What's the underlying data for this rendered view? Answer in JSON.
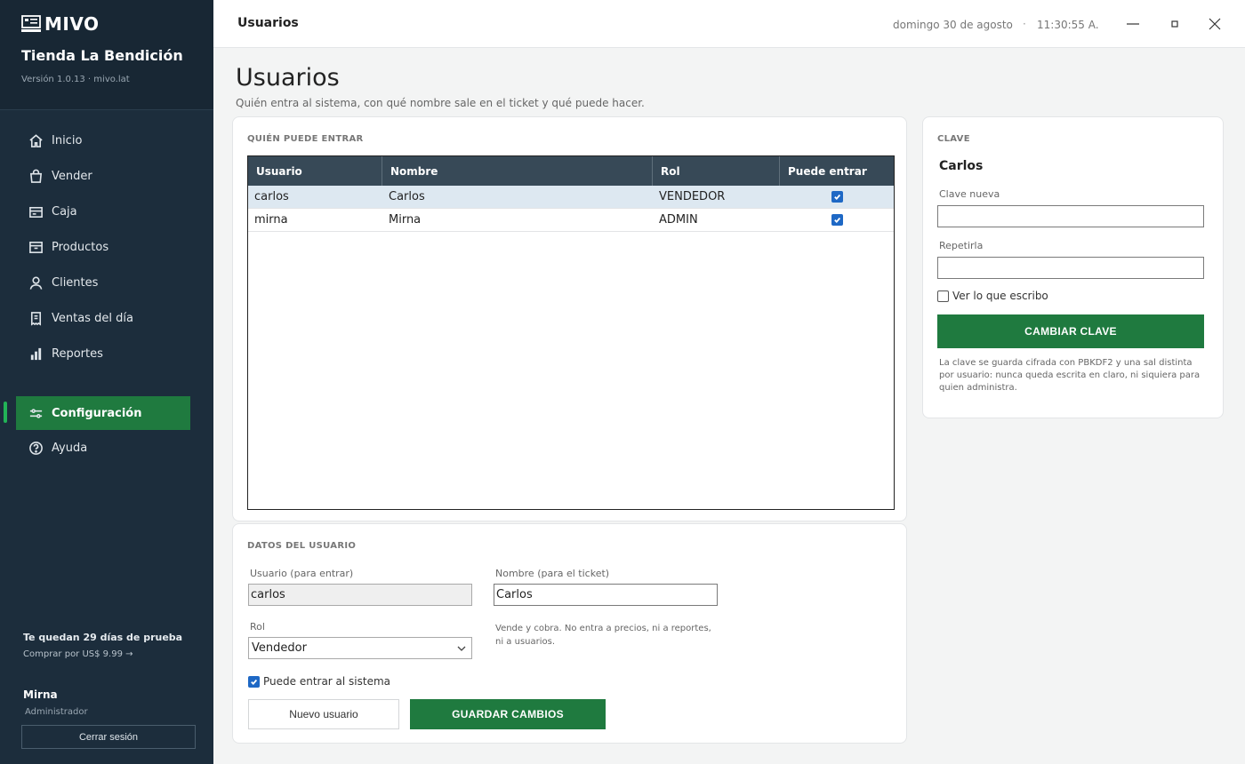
{
  "app": {
    "logo_text": "MIVO",
    "store_name": "Tienda La Bendición",
    "version": "Versión 1.0.13 · mivo.lat"
  },
  "sidebar": {
    "items": [
      {
        "label": "Inicio",
        "icon": "home-icon"
      },
      {
        "label": "Vender",
        "icon": "shopping-bag-icon"
      },
      {
        "label": "Caja",
        "icon": "cash-register-icon"
      },
      {
        "label": "Productos",
        "icon": "box-icon"
      },
      {
        "label": "Clientes",
        "icon": "user-icon"
      },
      {
        "label": "Ventas del día",
        "icon": "receipt-icon"
      },
      {
        "label": "Reportes",
        "icon": "bar-chart-icon"
      },
      {
        "label": "Configuración",
        "icon": "sliders-icon"
      },
      {
        "label": "Ayuda",
        "icon": "help-icon"
      }
    ],
    "active": "Configuración",
    "trial_title": "Te quedan 29 días de prueba",
    "trial_buy": "Comprar por US$ 9.99 →",
    "user_name": "Mirna",
    "user_role": "Administrador",
    "logout_label": "Cerrar sesión"
  },
  "topbar": {
    "title": "Usuarios",
    "date": "domingo 30 de agosto",
    "separator": "·",
    "time": "11:30:55 A."
  },
  "page": {
    "title": "Usuarios",
    "subtitle": "Quién entra al sistema, con qué nombre sale en el ticket y qué puede hacer."
  },
  "users_table": {
    "section_label": "QUIÉN PUEDE ENTRAR",
    "columns": [
      "Usuario",
      "Nombre",
      "Rol",
      "Puede entrar"
    ],
    "rows": [
      {
        "usuario": "carlos",
        "nombre": "Carlos",
        "rol": "VENDEDOR",
        "puede_entrar": true,
        "selected": true
      },
      {
        "usuario": "mirna",
        "nombre": "Mirna",
        "rol": "ADMIN",
        "puede_entrar": true,
        "selected": false
      }
    ]
  },
  "user_form": {
    "section_label": "DATOS DEL USUARIO",
    "usuario_label": "Usuario (para entrar)",
    "usuario_value": "carlos",
    "nombre_label": "Nombre (para el ticket)",
    "nombre_value": "Carlos",
    "rol_label": "Rol",
    "rol_value": "Vendedor",
    "rol_hint": "Vende y cobra. No entra a precios, ni a reportes, ni a usuarios.",
    "can_login_label": "Puede entrar al sistema",
    "can_login": true,
    "new_user_label": "Nuevo usuario",
    "save_label": "GUARDAR CAMBIOS"
  },
  "password_panel": {
    "section_label": "CLAVE",
    "user_display": "Carlos",
    "new_label": "Clave nueva",
    "repeat_label": "Repetirla",
    "show_label": "Ver lo que escribo",
    "button_label": "CAMBIAR CLAVE",
    "note": "La clave se guarda cifrada con PBKDF2 y una sal distinta por usuario: nunca queda escrita en claro, ni siquiera para quien administra."
  },
  "colors": {
    "sidebar_bg": "#1c2d3c",
    "accent_green": "#1f7a3f",
    "table_header": "#374957",
    "selected_row": "#dde8f1",
    "checkbox_blue": "#1e68c5"
  }
}
